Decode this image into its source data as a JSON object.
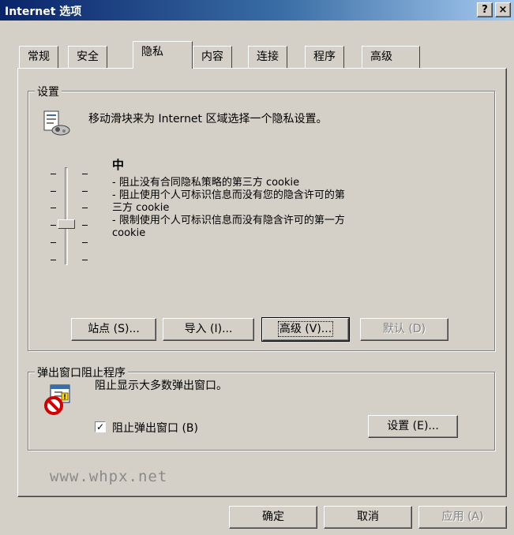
{
  "window": {
    "title": "Internet 选项",
    "help_button": "?",
    "close_button": "×"
  },
  "tabs": [
    {
      "label": "常规"
    },
    {
      "label": "安全"
    },
    {
      "label": "隐私"
    },
    {
      "label": "内容"
    },
    {
      "label": "连接"
    },
    {
      "label": "程序"
    },
    {
      "label": "高级"
    }
  ],
  "active_tab": "隐私",
  "settings": {
    "legend": "设置",
    "instruction": "移动滑块来为 Internet 区域选择一个隐私设置。",
    "level": "中",
    "level_value_fraction": 0.4,
    "descriptions": [
      "- 阻止没有合同隐私策略的第三方 cookie",
      "- 阻止使用个人可标识信息而没有您的隐含许可的第",
      "三方 cookie",
      "- 限制使用个人可标识信息而没有隐含许可的第一方",
      "cookie"
    ],
    "buttons": {
      "sites": "站点 (S)...",
      "import": "导入 (I)...",
      "advanced": "高级 (V)...",
      "default": "默认 (D)"
    }
  },
  "popup": {
    "legend": "弹出窗口阻止程序",
    "description": "阻止显示大多数弹出窗口。",
    "checkbox_label": "阻止弹出窗口 (B)",
    "checkbox_checked": true,
    "settings_button": "设置 (E)..."
  },
  "watermark": "www.whpx.net",
  "footer": {
    "ok": "确定",
    "cancel": "取消",
    "apply": "应用 (A)"
  }
}
